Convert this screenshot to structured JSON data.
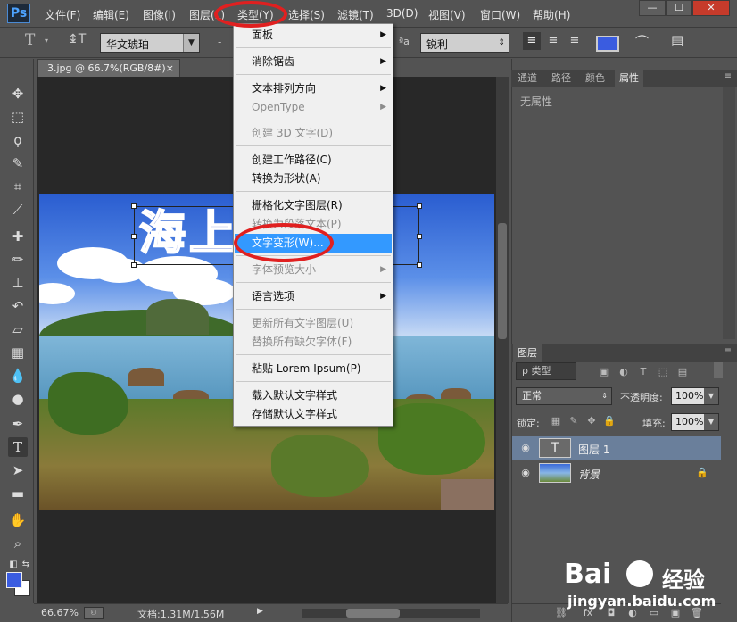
{
  "menubar": {
    "logo": "Ps",
    "items": [
      "文件(F)",
      "编辑(E)",
      "图像(I)",
      "图层(L)",
      "类型(Y)",
      "选择(S)",
      "滤镜(T)",
      "3D(D)",
      "视图(V)",
      "窗口(W)",
      "帮助(H)"
    ],
    "window_controls": [
      "—",
      "☐",
      "✕"
    ]
  },
  "options": {
    "font_family": "华文琥珀",
    "antialias_label": "ªa",
    "antialias_value": "锐利",
    "text_color": "#3a5ce0"
  },
  "document": {
    "tab_title": "3.jpg @ 66.7%(RGB/8#)",
    "tab_close": "×",
    "canvas_text": "海上遇见"
  },
  "dropdown": {
    "items": [
      {
        "label": "面板",
        "submenu": true,
        "enabled": true
      },
      {
        "label": "消除锯齿",
        "submenu": true,
        "enabled": true
      },
      {
        "label": "文本排列方向",
        "submenu": true,
        "enabled": true
      },
      {
        "label": "OpenType",
        "submenu": true,
        "enabled": false
      },
      {
        "label": "创建 3D 文字(D)",
        "submenu": false,
        "enabled": false
      },
      {
        "label": "创建工作路径(C)",
        "submenu": false,
        "enabled": true
      },
      {
        "label": "转换为形状(A)",
        "submenu": false,
        "enabled": true
      },
      {
        "label": "栅格化文字图层(R)",
        "submenu": false,
        "enabled": true
      },
      {
        "label": "转换为段落文本(P)",
        "submenu": false,
        "enabled": false
      },
      {
        "label": "文字变形(W)...",
        "submenu": false,
        "enabled": true,
        "highlighted": true
      },
      {
        "label": "字体预览大小",
        "submenu": true,
        "enabled": false
      },
      {
        "label": "语言选项",
        "submenu": true,
        "enabled": true
      },
      {
        "label": "更新所有文字图层(U)",
        "submenu": false,
        "enabled": false
      },
      {
        "label": "替换所有缺欠字体(F)",
        "submenu": false,
        "enabled": false
      },
      {
        "label": "粘贴 Lorem Ipsum(P)",
        "submenu": false,
        "enabled": true
      },
      {
        "label": "载入默认文字样式",
        "submenu": false,
        "enabled": true
      },
      {
        "label": "存储默认文字样式",
        "submenu": false,
        "enabled": true
      }
    ]
  },
  "panels": {
    "top_tabs": [
      "通道",
      "路径",
      "颜色",
      "属性"
    ],
    "properties_empty": "无属性",
    "layers_tab": "图层",
    "filter_label": "ρ 类型",
    "blend_mode": "正常",
    "opacity_label": "不透明度:",
    "opacity_value": "100%",
    "lock_label": "锁定:",
    "fill_label": "填充:",
    "fill_value": "100%",
    "layers": [
      {
        "name": "图层 1",
        "type": "text",
        "selected": true
      },
      {
        "name": "背景",
        "type": "image",
        "selected": false,
        "locked": true
      }
    ]
  },
  "status": {
    "zoom": "66.67%",
    "doc_info": "文档:1.31M/1.56M"
  },
  "watermark": {
    "brand": "Bai",
    "brand_cn": "经验",
    "url": "jingyan.baidu.com"
  }
}
